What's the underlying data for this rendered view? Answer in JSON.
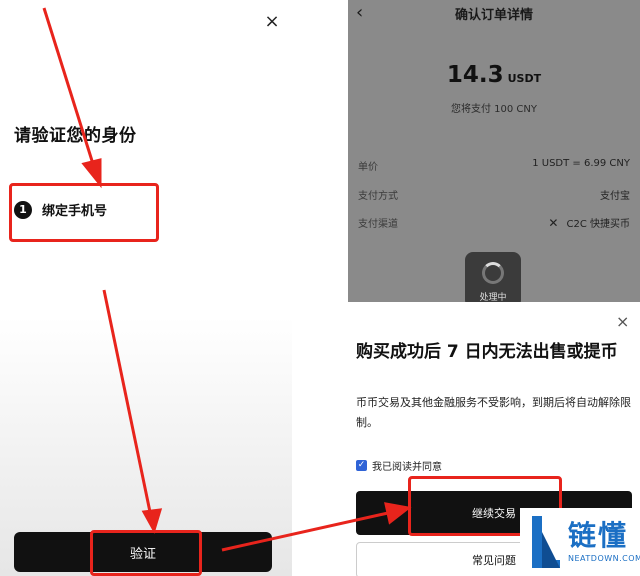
{
  "left_screen": {
    "close_glyph": "×",
    "title": "请验证您的身份",
    "step_number": "1",
    "step_label": "绑定手机号",
    "verify_button": "验证"
  },
  "right_screen": {
    "back_glyph": "‹",
    "page_title": "确认订单详情",
    "amount": "14.3",
    "currency": "USDT",
    "pay_note": "您将支付 100 CNY",
    "rows": [
      {
        "key": "单价",
        "value": "1 USDT = 6.99 CNY"
      },
      {
        "key": "支付方式",
        "value": "支付宝"
      },
      {
        "key": "支付渠道",
        "value": "C2C 快捷买币"
      }
    ],
    "processing_label": "处理中",
    "sheet": {
      "close_glyph": "×",
      "title": "购买成功后 7 日内无法出售或提币",
      "description": "币币交易及其他金融服务不受影响，到期后将自动解除限制。",
      "agree_label": "我已阅读并同意",
      "agree_checked": true,
      "continue_button": "继续交易",
      "faq_button": "常见问题"
    }
  },
  "logo": {
    "text": "链懂",
    "subtext": "NEATDOWN.COM"
  },
  "colors": {
    "highlight": "#e8241c",
    "arrow": "#e8241c",
    "brand": "#1b6fc4",
    "checkbox": "#2f63d6"
  }
}
